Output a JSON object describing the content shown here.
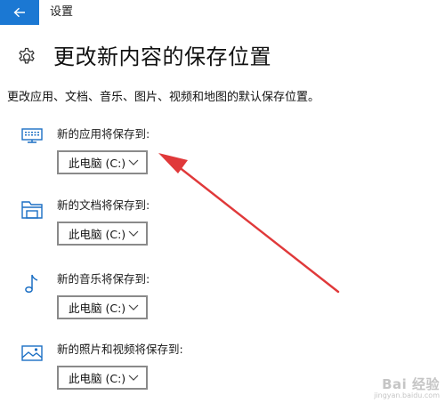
{
  "window": {
    "title": "设置"
  },
  "page": {
    "title": "更改新内容的保存位置",
    "description": "更改应用、文档、音乐、图片、视频和地图的默认保存位置。"
  },
  "sections": [
    {
      "label": "新的应用将保存到:",
      "selected": "此电脑 (C:)",
      "icon": "monitor-icon"
    },
    {
      "label": "新的文档将保存到:",
      "selected": "此电脑 (C:)",
      "icon": "document-folder-icon"
    },
    {
      "label": "新的音乐将保存到:",
      "selected": "此电脑 (C:)",
      "icon": "music-note-icon"
    },
    {
      "label": "新的照片和视频将保存到:",
      "selected": "此电脑 (C:)",
      "icon": "picture-icon"
    }
  ],
  "colors": {
    "accent": "#1b78d3",
    "icon": "#1b6fc4",
    "annotation_arrow": "#e0393a",
    "watermark": "#c5c5c5"
  },
  "watermark": {
    "main": "Bai 经验",
    "sub": "jingyan.baidu.com"
  }
}
